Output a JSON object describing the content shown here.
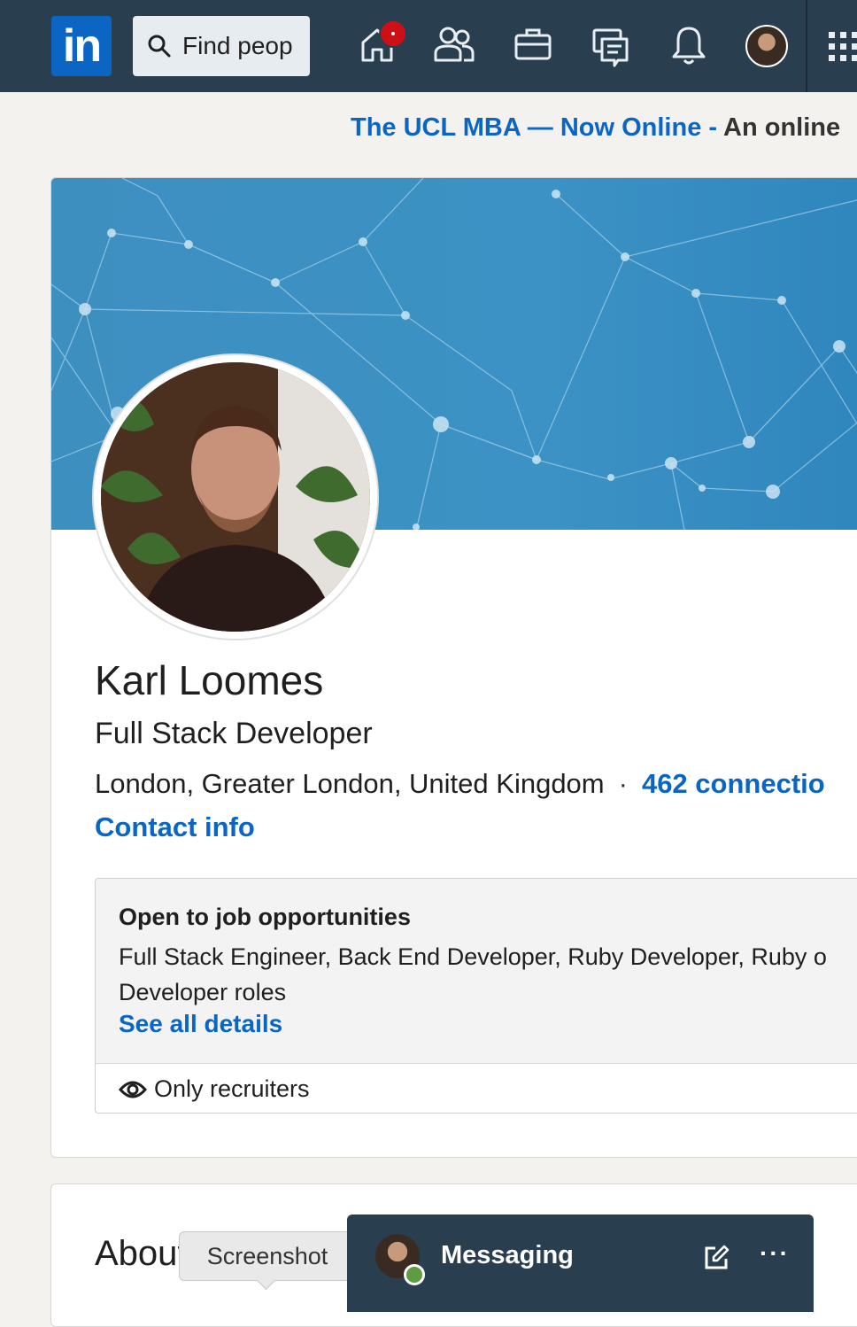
{
  "nav": {
    "logo_text": "in",
    "search_placeholder": "Find peop",
    "icons": [
      "home-icon",
      "my-network-icon",
      "jobs-icon",
      "messaging-icon",
      "notifications-icon",
      "me-avatar",
      "apps-grid-icon"
    ],
    "brand_color": "#0a66c2",
    "bar_color": "#293e4f",
    "badge_color": "#cc1016"
  },
  "ad": {
    "link_text": "The UCL MBA — Now Online -",
    "rest_text": "An online"
  },
  "profile": {
    "name": "Karl Loomes",
    "headline": "Full Stack Developer",
    "location": "London, Greater London, United Kingdom",
    "separator": "·",
    "connections": "462 connectio",
    "contact_info": "Contact info"
  },
  "open_to_work": {
    "title": "Open to job opportunities",
    "roles": "Full Stack Engineer, Back End Developer, Ruby Developer, Ruby o Developer roles",
    "see_all": "See all details",
    "visibility": "Only recruiters"
  },
  "about": {
    "title": "About"
  },
  "tooltip": {
    "text": "Screenshot"
  },
  "messaging": {
    "label": "Messaging",
    "more": "···"
  }
}
